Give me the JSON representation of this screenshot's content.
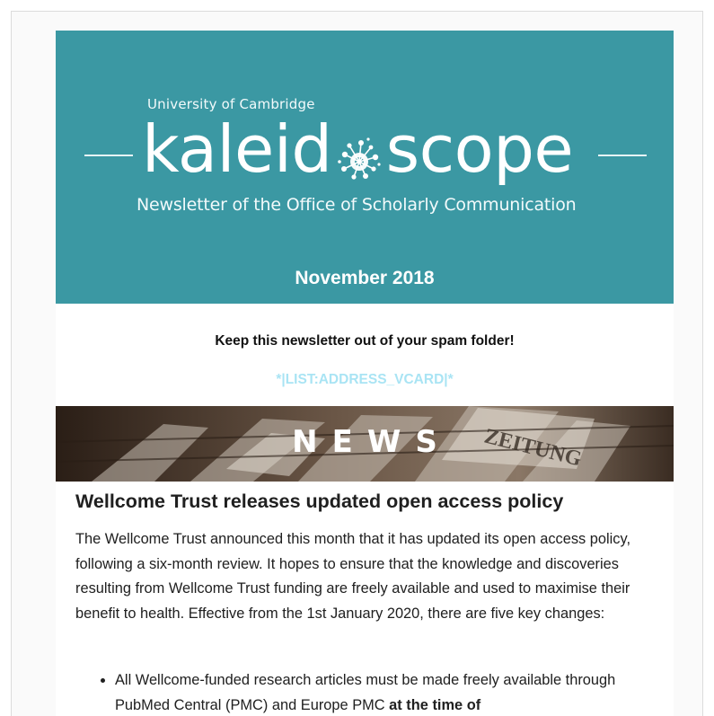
{
  "header": {
    "university": "University of Cambridge",
    "wordmark_left": "kaleid",
    "wordmark_right": "scope",
    "tagline": "Newsletter of the Office of Scholarly Communication",
    "issue_date": "November 2018",
    "background_color": "#3b98a3"
  },
  "notice": {
    "spam_text": "Keep this newsletter out of your spam folder!",
    "vcard_tag": "*|LIST:ADDRESS_VCARD|*",
    "vcard_color": "#a9e4f4"
  },
  "section": {
    "label": "NEWS",
    "image_text": "ZEITUNG"
  },
  "article": {
    "title": "Wellcome Trust releases updated open access policy",
    "body": "The Wellcome Trust announced this month that it has updated its open access policy, following a six-month review. It hopes to ensure that the knowledge and discoveries resulting from Wellcome Trust funding are freely available and used to maximise their benefit to health. Effective from the 1st January 2020, there are five key changes:",
    "bullets": [
      {
        "text": "All Wellcome-funded research articles must be made freely available through PubMed Central (PMC) and Europe PMC ",
        "emphasis": "at the time of"
      }
    ]
  },
  "icons": {
    "flower": "dandelion-flower-icon",
    "bullet": "bullet-dot-icon"
  }
}
